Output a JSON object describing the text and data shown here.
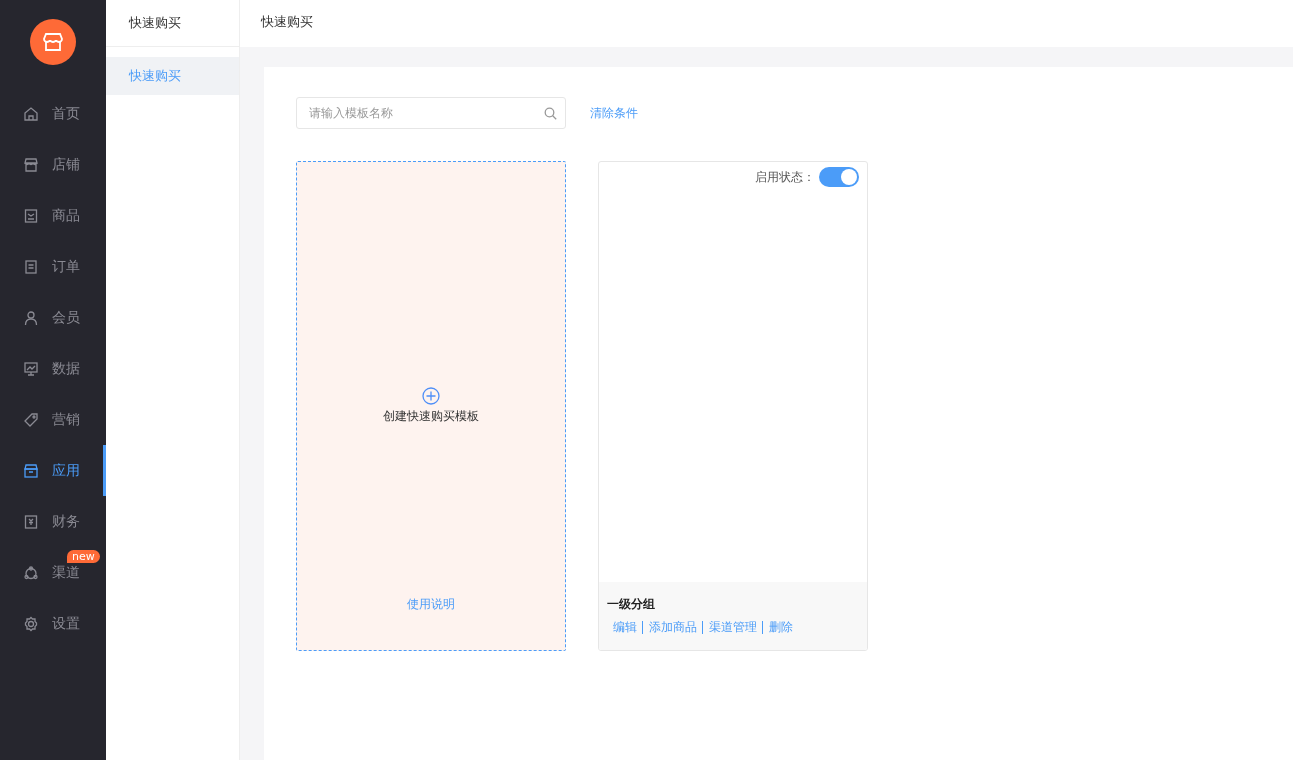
{
  "nav": {
    "items": [
      {
        "label": "首页",
        "selected": false
      },
      {
        "label": "店铺",
        "selected": false
      },
      {
        "label": "商品",
        "selected": false
      },
      {
        "label": "订单",
        "selected": false
      },
      {
        "label": "会员",
        "selected": false
      },
      {
        "label": "数据",
        "selected": false
      },
      {
        "label": "营销",
        "selected": false
      },
      {
        "label": "应用",
        "selected": true
      },
      {
        "label": "财务",
        "selected": false
      },
      {
        "label": "渠道",
        "selected": false,
        "badge": "new"
      },
      {
        "label": "设置",
        "selected": false
      }
    ]
  },
  "subnav": {
    "title": "快速购买",
    "items": [
      {
        "label": "快速购买",
        "selected": true
      }
    ]
  },
  "header": {
    "title": "快速购买"
  },
  "search": {
    "placeholder": "请输入模板名称"
  },
  "clear_link": "清除条件",
  "create_card": {
    "label": "创建快速购买模板",
    "help_link": "使用说明"
  },
  "templates": [
    {
      "status_label": "启用状态：",
      "enabled": true,
      "name": "一级分组",
      "actions": [
        "编辑",
        "添加商品",
        "渠道管理",
        "删除"
      ]
    }
  ]
}
